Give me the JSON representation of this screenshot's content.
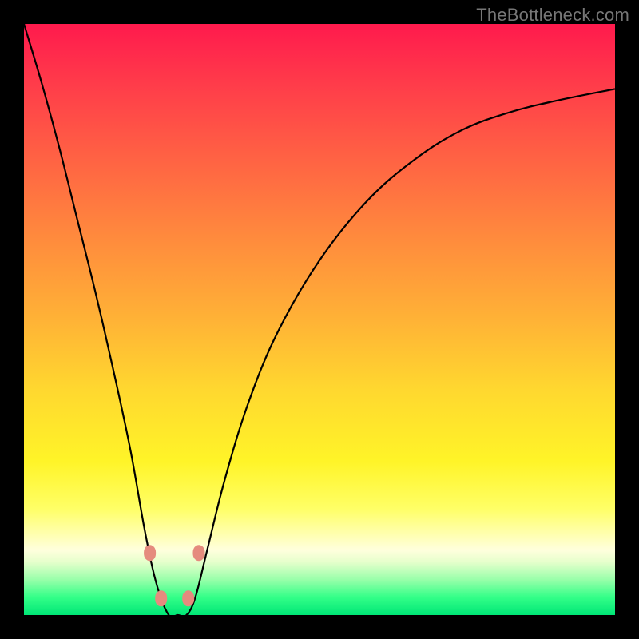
{
  "watermark": "TheBottleneck.com",
  "colors": {
    "curve": "#000000",
    "marker": "#e58b7e",
    "background": "#000000"
  },
  "chart_data": {
    "type": "line",
    "title": "",
    "xlabel": "",
    "ylabel": "",
    "xlim": [
      0,
      1
    ],
    "ylim": [
      0,
      1
    ],
    "note": "Axes are unlabeled in the source image; values are normalized estimates read from pixel positions. y represents curve height (0 at bottom/green, 1 at top/red).",
    "x": [
      0.0,
      0.03,
      0.06,
      0.09,
      0.12,
      0.15,
      0.18,
      0.205,
      0.225,
      0.245,
      0.26,
      0.275,
      0.29,
      0.31,
      0.34,
      0.38,
      0.43,
      0.5,
      0.58,
      0.66,
      0.74,
      0.82,
      0.9,
      1.0
    ],
    "y": [
      1.0,
      0.9,
      0.79,
      0.67,
      0.55,
      0.42,
      0.28,
      0.14,
      0.05,
      0.0,
      0.0,
      0.0,
      0.03,
      0.11,
      0.23,
      0.36,
      0.48,
      0.6,
      0.7,
      0.77,
      0.82,
      0.85,
      0.87,
      0.89
    ],
    "markers": [
      {
        "x": 0.213,
        "y": 0.105
      },
      {
        "x": 0.232,
        "y": 0.028
      },
      {
        "x": 0.278,
        "y": 0.028
      },
      {
        "x": 0.296,
        "y": 0.105
      }
    ],
    "marker_radius_px": 10
  }
}
